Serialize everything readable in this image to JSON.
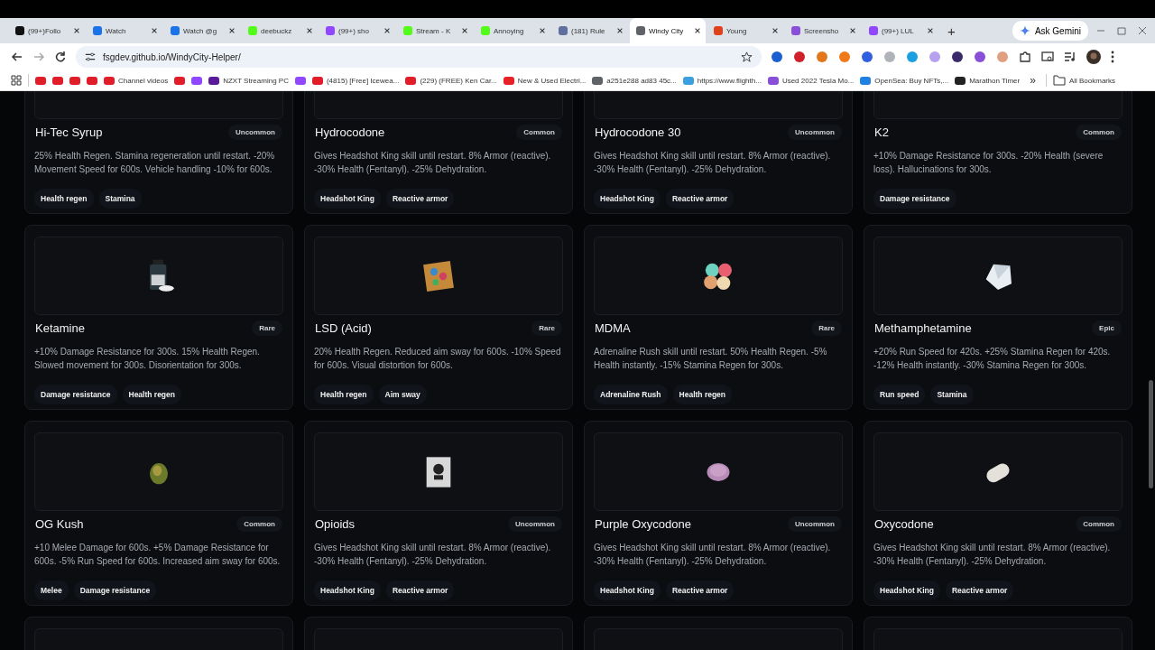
{
  "browser": {
    "tabs": [
      {
        "title": "(99+)Follo",
        "selected": false,
        "color": "#111111"
      },
      {
        "title": "Watch",
        "selected": false,
        "color": "#1a73e8"
      },
      {
        "title": "Watch @g",
        "selected": false,
        "color": "#1a73e8"
      },
      {
        "title": "deebuckz",
        "selected": false,
        "color": "#53fc18"
      },
      {
        "title": "(99+) sho",
        "selected": false,
        "color": "#9146ff"
      },
      {
        "title": "Stream - K",
        "selected": false,
        "color": "#53fc18"
      },
      {
        "title": "Annoying",
        "selected": false,
        "color": "#53fc18"
      },
      {
        "title": "(181) Rule",
        "selected": false,
        "color": "#5f6fa0"
      },
      {
        "title": "Windy City",
        "selected": true,
        "color": "#5f6368"
      },
      {
        "title": "Young",
        "selected": false,
        "color": "#e0401a"
      },
      {
        "title": "Screensho",
        "selected": false,
        "color": "#8a4fd8"
      },
      {
        "title": "(99+) LUL",
        "selected": false,
        "color": "#9146ff"
      }
    ],
    "new_tab": "+",
    "gemini": "Ask Gemini",
    "url": "fsgdev.github.io/WindyCity-Helper/",
    "bookmarks": [
      {
        "color": "#e11d2a"
      },
      {
        "color": "#e11d2a"
      },
      {
        "color": "#e11d2a"
      },
      {
        "color": "#e11d2a"
      },
      {
        "label": "Channel videos",
        "color": "#e11d2a"
      },
      {
        "color": "#e11d2a"
      },
      {
        "color": "#9146ff"
      },
      {
        "label": "NZXT Streaming PC",
        "color": "#5b1a9a"
      },
      {
        "color": "#9146ff"
      },
      {
        "label": "(4815) [Free] Icewea...",
        "color": "#e11d2a"
      },
      {
        "label": "(229) (FREE) Ken Car...",
        "color": "#e11d2a"
      },
      {
        "label": "New & Used Electri...",
        "color": "#e82127"
      },
      {
        "label": "a251e288 ad83 45c...",
        "color": "#5f6368"
      },
      {
        "label": "https://www.flighth...",
        "color": "#3aa0e0"
      },
      {
        "label": "Used 2022 Tesla Mo...",
        "color": "#8a4fd8"
      },
      {
        "label": "OpenSea: Buy NFTs,...",
        "color": "#2081e2"
      },
      {
        "label": "Marathon Timer",
        "color": "#222222"
      }
    ],
    "more": "»",
    "all_bookmarks": "All Bookmarks"
  },
  "items": [
    {
      "name": "Hi-Tec Syrup",
      "rarity": "Uncommon",
      "description": "25% Health Regen. Stamina regeneration until restart. -20% Movement Speed for 600s. Vehicle handling -10% for 600s.",
      "tags": [
        "Health regen",
        "Stamina"
      ]
    },
    {
      "name": "Hydrocodone",
      "rarity": "Common",
      "description": "Gives Headshot King skill until restart. 8% Armor (reactive). -30% Health (Fentanyl). -25% Dehydration.",
      "tags": [
        "Headshot King",
        "Reactive armor"
      ]
    },
    {
      "name": "Hydrocodone 30",
      "rarity": "Uncommon",
      "description": "Gives Headshot King skill until restart. 8% Armor (reactive). -30% Health (Fentanyl). -25% Dehydration.",
      "tags": [
        "Headshot King",
        "Reactive armor"
      ]
    },
    {
      "name": "K2",
      "rarity": "Common",
      "description": "+10% Damage Resistance for 300s. -20% Health (severe loss). Hallucinations for 300s.",
      "tags": [
        "Damage resistance"
      ]
    },
    {
      "name": "Ketamine",
      "rarity": "Rare",
      "description": "+10% Damage Resistance for 300s. 15% Health Regen. Slowed movement for 300s. Disorientation for 300s.",
      "tags": [
        "Damage resistance",
        "Health regen"
      ]
    },
    {
      "name": "LSD (Acid)",
      "rarity": "Rare",
      "description": "20% Health Regen. Reduced aim sway for 600s. -10% Speed for 600s. Visual distortion for 600s.",
      "tags": [
        "Health regen",
        "Aim sway"
      ]
    },
    {
      "name": "MDMA",
      "rarity": "Rare",
      "description": "Adrenaline Rush skill until restart. 50% Health Regen. -5% Health instantly. -15% Stamina Regen for 300s.",
      "tags": [
        "Adrenaline Rush",
        "Health regen"
      ]
    },
    {
      "name": "Methamphetamine",
      "rarity": "Epic",
      "description": "+20% Run Speed for 420s. +25% Stamina Regen for 420s. -12% Health instantly. -30% Stamina Regen for 300s.",
      "tags": [
        "Run speed",
        "Stamina"
      ]
    },
    {
      "name": "OG Kush",
      "rarity": "Common",
      "description": "+10 Melee Damage for 600s. +5% Damage Resistance for 600s. -5% Run Speed for 600s. Increased aim sway for 600s.",
      "tags": [
        "Melee",
        "Damage resistance"
      ]
    },
    {
      "name": "Opioids",
      "rarity": "Uncommon",
      "description": "Gives Headshot King skill until restart. 8% Armor (reactive). -30% Health (Fentanyl). -25% Dehydration.",
      "tags": [
        "Headshot King",
        "Reactive armor"
      ]
    },
    {
      "name": "Purple Oxycodone",
      "rarity": "Uncommon",
      "description": "Gives Headshot King skill until restart. 8% Armor (reactive). -30% Health (Fentanyl). -25% Dehydration.",
      "tags": [
        "Headshot King",
        "Reactive armor"
      ]
    },
    {
      "name": "Oxycodone",
      "rarity": "Common",
      "description": "Gives Headshot King skill until restart. 8% Armor (reactive). -30% Health (Fentanyl). -25% Dehydration.",
      "tags": [
        "Headshot King",
        "Reactive armor"
      ]
    }
  ]
}
